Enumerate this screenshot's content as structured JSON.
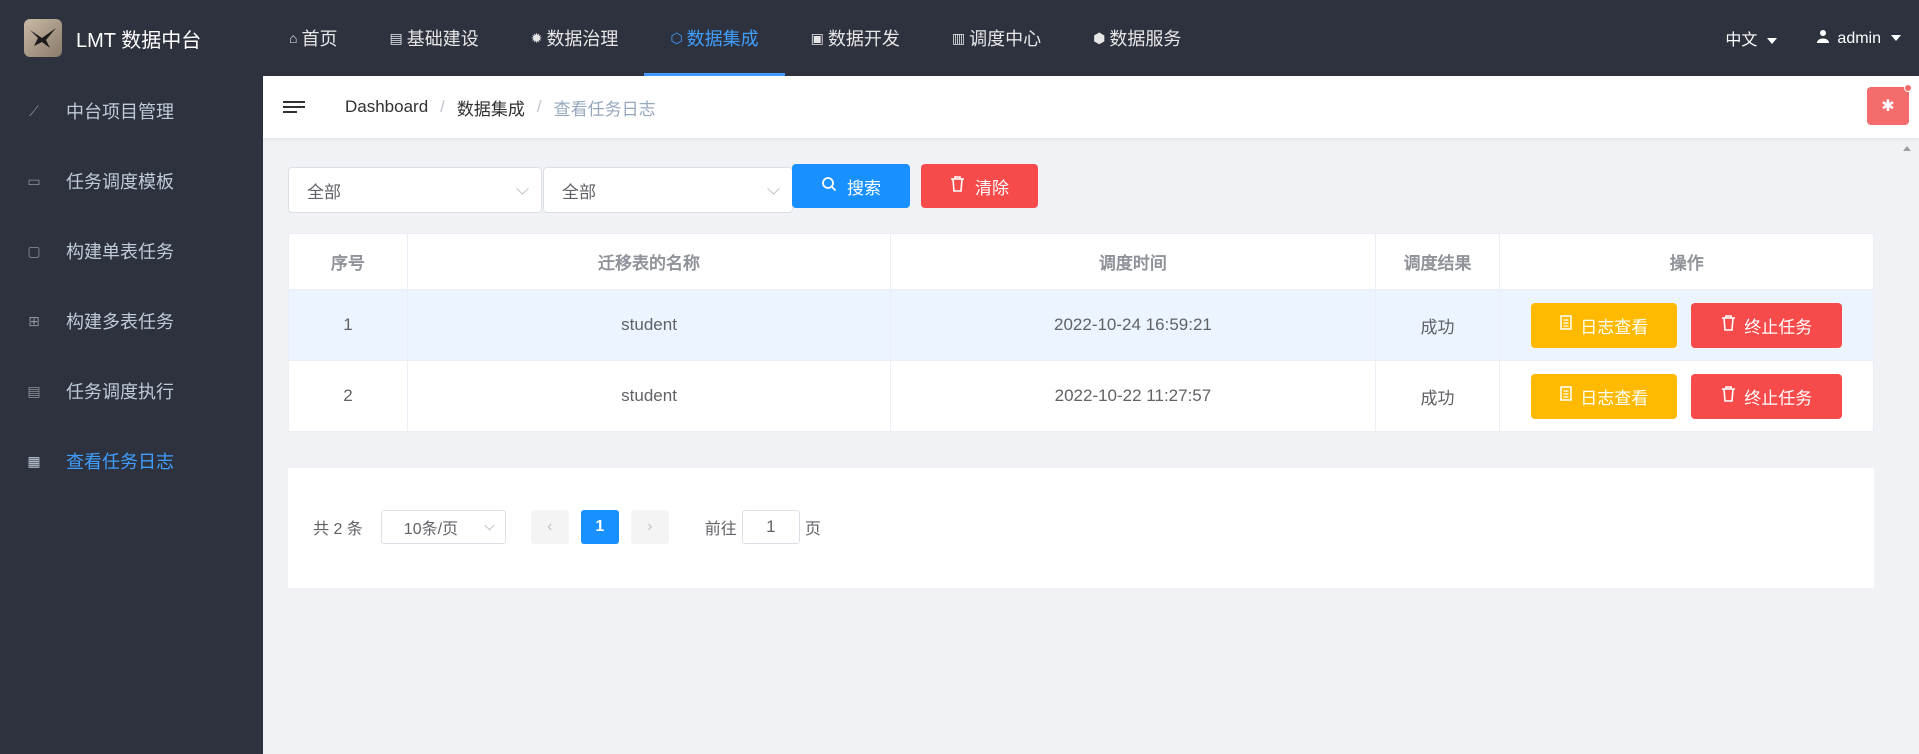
{
  "app": {
    "title": "LMT 数据中台"
  },
  "topnav": [
    {
      "label": "首页",
      "icon": "home-icon",
      "glyph": "⌂",
      "active": false
    },
    {
      "label": "基础建设",
      "icon": "document-icon",
      "glyph": "▤",
      "active": false
    },
    {
      "label": "数据治理",
      "icon": "gear-icon",
      "glyph": "✹",
      "active": false
    },
    {
      "label": "数据集成",
      "icon": "cube-icon",
      "glyph": "⬡",
      "active": true
    },
    {
      "label": "数据开发",
      "icon": "monitor-icon",
      "glyph": "▣",
      "active": false
    },
    {
      "label": "调度中心",
      "icon": "clipboard-icon",
      "glyph": "▥",
      "active": false
    },
    {
      "label": "数据服务",
      "icon": "box-icon",
      "glyph": "⬢",
      "active": false
    }
  ],
  "topright": {
    "lang": "中文",
    "user": "admin"
  },
  "sidebar": [
    {
      "label": "中台项目管理",
      "icon": "chart-line-icon",
      "glyph": "⟋",
      "active": false
    },
    {
      "label": "任务调度模板",
      "icon": "template-icon",
      "glyph": "▭",
      "active": false
    },
    {
      "label": "构建单表任务",
      "icon": "single-table-icon",
      "glyph": "▢",
      "active": false
    },
    {
      "label": "构建多表任务",
      "icon": "multi-table-icon",
      "glyph": "⊞",
      "active": false
    },
    {
      "label": "任务调度执行",
      "icon": "execute-icon",
      "glyph": "▤",
      "active": false
    },
    {
      "label": "查看任务日志",
      "icon": "log-icon",
      "glyph": "▦",
      "active": true
    }
  ],
  "breadcrumb": [
    "Dashboard",
    "数据集成",
    "查看任务日志"
  ],
  "filters": {
    "select1": "全部",
    "select2": "全部",
    "search_label": "搜索",
    "clear_label": "清除"
  },
  "table": {
    "headers": [
      "序号",
      "迁移表的名称",
      "调度时间",
      "调度结果",
      "操作"
    ],
    "rows": [
      {
        "index": "1",
        "name": "student",
        "time": "2022-10-24 16:59:21",
        "result": "成功",
        "highlighted": true
      },
      {
        "index": "2",
        "name": "student",
        "time": "2022-10-22 11:27:57",
        "result": "成功",
        "highlighted": false
      }
    ],
    "view_log_label": "日志查看",
    "stop_task_label": "终止任务"
  },
  "pagination": {
    "total": "共 2 条",
    "page_size": "10条/页",
    "current": "1",
    "goto_prefix": "前往",
    "goto_value": "1",
    "goto_suffix": "页"
  },
  "colors": {
    "topbar": "#2d323e",
    "accent": "#409eff",
    "primary": "#1890ff",
    "danger": "#f74a4a",
    "warning": "#ffba00"
  }
}
